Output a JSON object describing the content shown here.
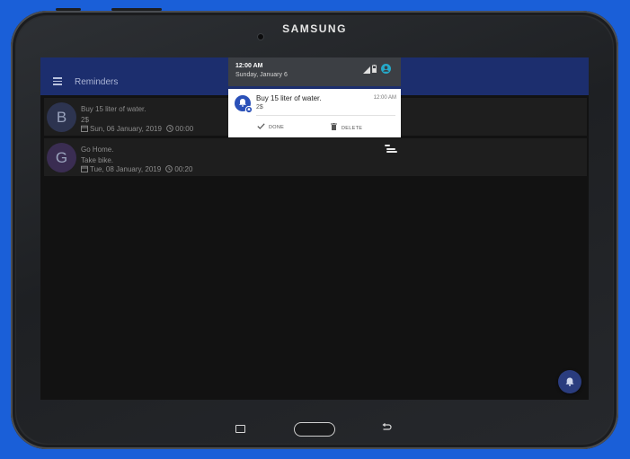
{
  "device": {
    "brand": "SAMSUNG"
  },
  "app": {
    "title": "Reminders",
    "menu_icon": "hamburger-menu-icon",
    "primary_color": "#1c2e6e",
    "reminders": [
      {
        "avatar_letter": "B",
        "avatar_color": "#2d3450",
        "title": "Buy 15 liter of water.",
        "note": "2$",
        "date": "Sun, 06 January, 2019",
        "time": "00:00"
      },
      {
        "avatar_letter": "G",
        "avatar_color": "#3a2d52",
        "title": "Go Home.",
        "note": "Take bike.",
        "date": "Tue, 08 January, 2019",
        "time": "00:20"
      }
    ],
    "fab_icon": "bell-icon"
  },
  "status_shade": {
    "time": "12:00 AM",
    "date": "Sunday, January 6"
  },
  "notification": {
    "title": "Buy 15 liter of water.",
    "body": "2$",
    "time": "12:00 AM",
    "icon": "bell-icon",
    "actions": {
      "done": "DONE",
      "delete": "DELETE"
    }
  }
}
